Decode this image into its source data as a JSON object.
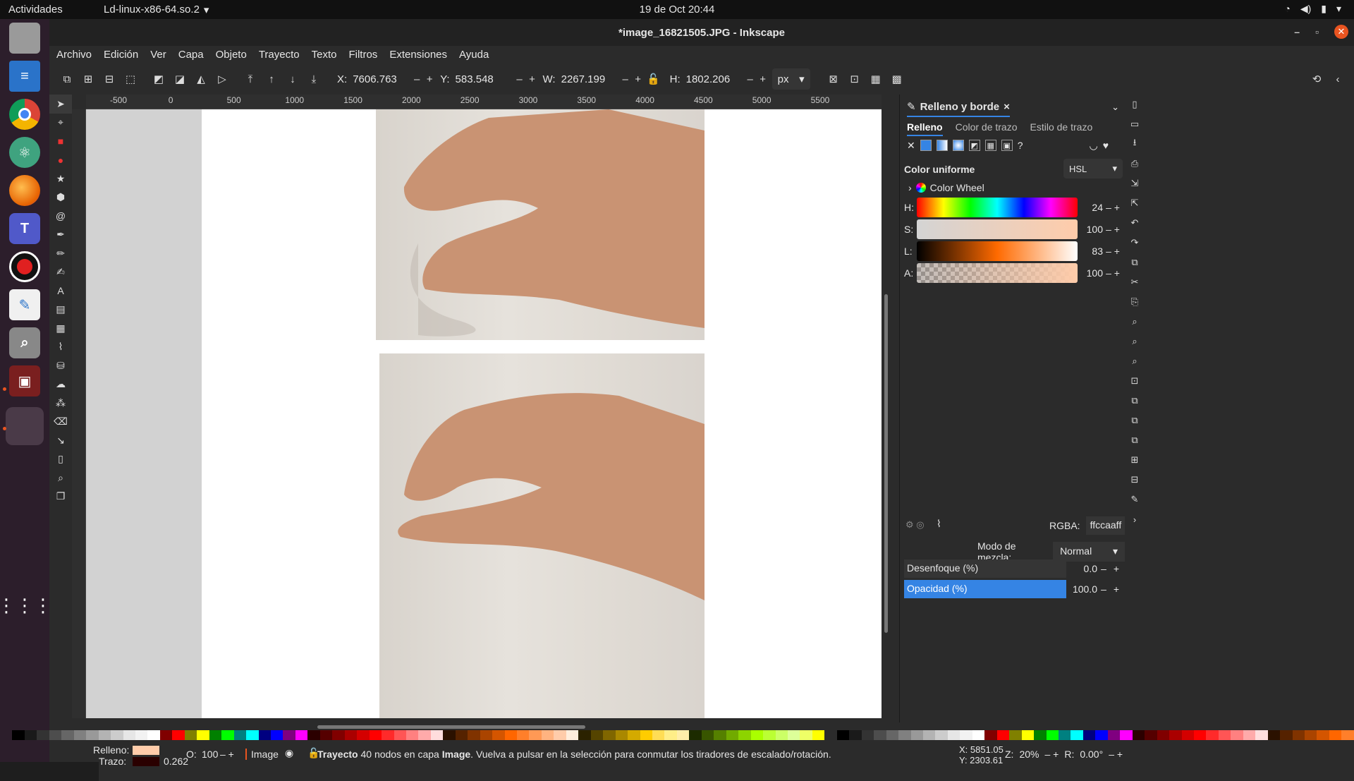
{
  "topbar": {
    "activities": "Actividades",
    "app_name": "Ld-linux-x86-64.so.2",
    "clock": "19 de Oct  20:44"
  },
  "window": {
    "title": "*image_16821505.JPG - Inkscape"
  },
  "menubar": {
    "items": [
      "Archivo",
      "Edición",
      "Ver",
      "Capa",
      "Objeto",
      "Trayecto",
      "Texto",
      "Filtros",
      "Extensiones",
      "Ayuda"
    ]
  },
  "toolbar": {
    "x_label": "X:",
    "x_value": "7606.763",
    "y_label": "Y:",
    "y_value": "583.548",
    "w_label": "W:",
    "w_value": "2267.199",
    "h_label": "H:",
    "h_value": "1802.206",
    "unit": "px"
  },
  "ruler": {
    "ticks": [
      "-500",
      "0",
      "500",
      "1000",
      "1500",
      "2000",
      "2500",
      "3000",
      "3500",
      "4000",
      "4500",
      "5000",
      "5500"
    ]
  },
  "panel": {
    "tab_title": "Relleno y borde",
    "subtabs": [
      "Relleno",
      "Color de trazo",
      "Estilo de trazo"
    ],
    "flat_label": "Color uniforme",
    "mode": "HSL",
    "wheel_label": "Color Wheel",
    "sliders": [
      {
        "label": "H:",
        "value": "24"
      },
      {
        "label": "S:",
        "value": "100"
      },
      {
        "label": "L:",
        "value": "83"
      },
      {
        "label": "A:",
        "value": "100"
      }
    ],
    "rgba_label": "RGBA:",
    "rgba_value": "ffccaaff",
    "blend_label": "Modo de mezcla:",
    "blend_value": "Normal",
    "blur_label": "Desenfoque (%)",
    "blur_value": "0.0",
    "opacity_label": "Opacidad (%)",
    "opacity_value": "100.0",
    "fill_color": "#ffccaa"
  },
  "statusbar": {
    "fill_label": "Relleno:",
    "stroke_label": "Trazo:",
    "stroke_width": "0.262",
    "opacity_label": "O:",
    "opacity_value": "100",
    "layer": "Image",
    "message_bold": "Trayecto",
    "message": " 40 nodos en capa ",
    "message_layer": "Image",
    "message_tail": ". Vuelva a pulsar en la selección para conmutar los tiradores de escalado/rotación.",
    "cursor_x": "X: 5851.05",
    "cursor_y": "Y: 2303.61",
    "zoom_label": "Z:",
    "zoom_value": "20%",
    "rotation_label": "R:",
    "rotation_value": "0.00°"
  }
}
